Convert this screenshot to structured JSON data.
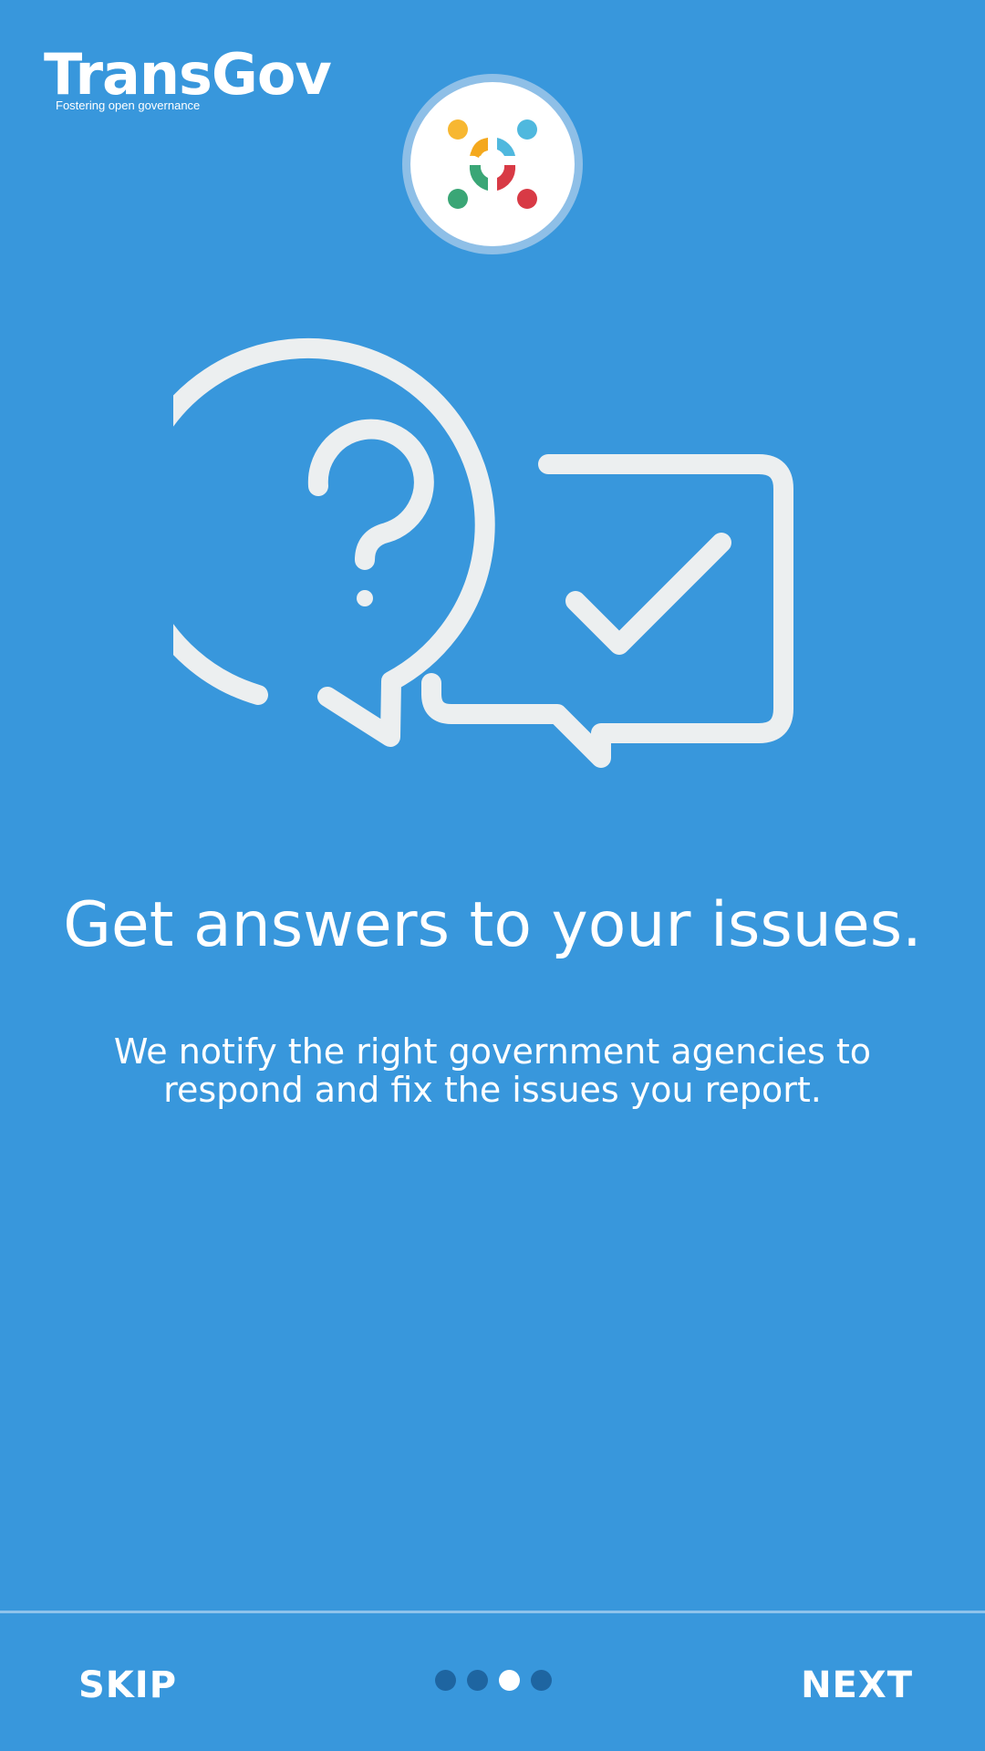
{
  "app": {
    "brand_name": "TransGov",
    "brand_tagline": "Fostering open governance"
  },
  "onboarding": {
    "headline": "Get answers to your issues.",
    "description": "We notify the right government agencies to respond and fix the issues you report.",
    "illustration_icon": "question-answer-chat-icon",
    "page_index": 3,
    "page_count": 4
  },
  "footer": {
    "skip_label": "SKIP",
    "next_label": "NEXT"
  },
  "colors": {
    "background": "#3897dc",
    "illustration_stroke": "#eceff0",
    "dot_inactive": "#1e65a1",
    "dot_active": "#ffffff",
    "logo_yellow": "#f7b731",
    "logo_blue": "#4fb8de",
    "logo_green": "#3aa676",
    "logo_red": "#d83a45"
  }
}
